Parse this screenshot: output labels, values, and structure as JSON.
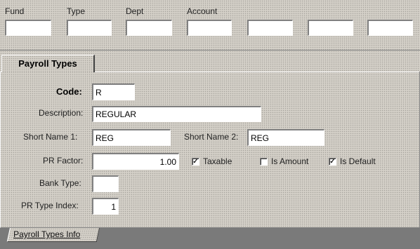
{
  "header": {
    "labels": {
      "fund": "Fund",
      "type": "Type",
      "dept": "Dept",
      "account": "Account"
    },
    "fields": [
      "",
      "",
      "",
      "",
      "",
      "",
      ""
    ]
  },
  "tabs": {
    "active": "Payroll Types"
  },
  "form": {
    "code_label": "Code:",
    "code_value": "R",
    "description_label": "Description:",
    "description_value": "REGULAR",
    "short_name1_label": "Short Name 1:",
    "short_name1_value": "REG",
    "short_name2_label": "Short Name 2:",
    "short_name2_value": "REG",
    "pr_factor_label": "PR Factor:",
    "pr_factor_value": "1.00",
    "taxable_label": "Taxable",
    "taxable_checked": true,
    "is_amount_label": "Is Amount",
    "is_amount_checked": false,
    "is_default_label": "Is Default",
    "is_default_checked": true,
    "bank_type_label": "Bank Type:",
    "bank_type_value": "",
    "pr_type_index_label": "PR Type Index:",
    "pr_type_index_value": "1"
  },
  "bottom_tabs": {
    "info_label": "Payroll Types Info"
  }
}
